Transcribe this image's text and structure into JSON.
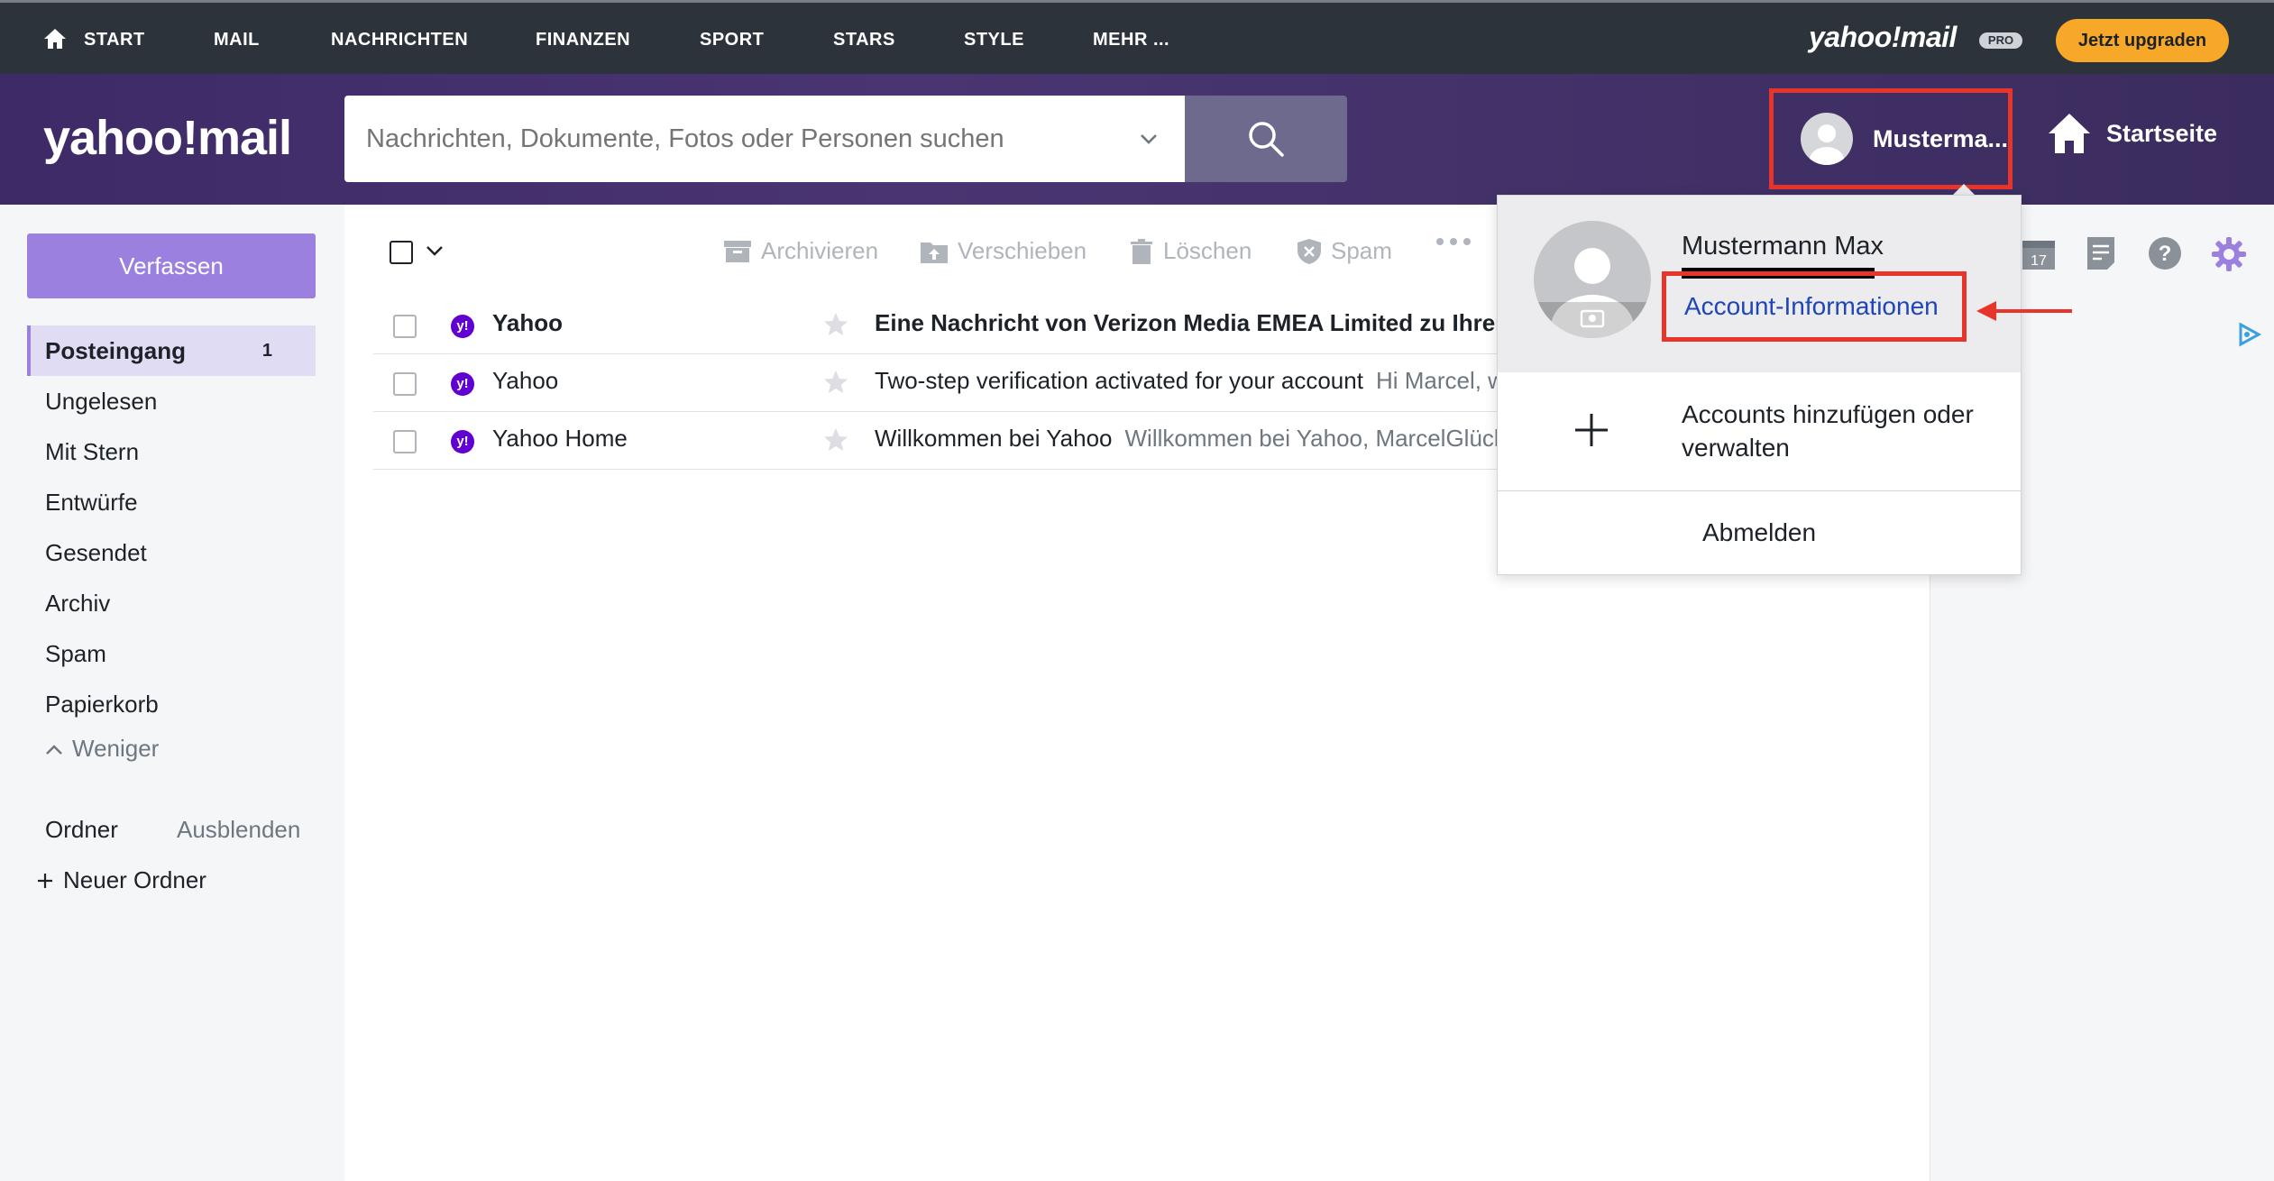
{
  "topnav": {
    "items": [
      "START",
      "MAIL",
      "NACHRICHTEN",
      "FINANZEN",
      "SPORT",
      "STARS",
      "STYLE",
      "MEHR ..."
    ],
    "brand": "yahoo!mail",
    "pro_badge": "PRO",
    "upgrade_label": "Jetzt upgraden"
  },
  "header": {
    "logo": "yahoo!mail",
    "search_placeholder": "Nachrichten, Dokumente, Fotos oder Personen suchen",
    "account_name": "Musterma...",
    "home_label": "Startseite"
  },
  "sidebar": {
    "compose_label": "Verfassen",
    "folders": [
      {
        "label": "Posteingang",
        "count": "1"
      },
      {
        "label": "Ungelesen"
      },
      {
        "label": "Mit Stern"
      },
      {
        "label": "Entwürfe"
      },
      {
        "label": "Gesendet"
      },
      {
        "label": "Archiv"
      },
      {
        "label": "Spam"
      },
      {
        "label": "Papierkorb"
      }
    ],
    "less_label": "Weniger",
    "folders_label": "Ordner",
    "hide_label": "Ausblenden",
    "new_folder_label": "Neuer Ordner"
  },
  "toolbar": {
    "archive": "Archivieren",
    "move": "Verschieben",
    "delete": "Löschen",
    "spam": "Spam"
  },
  "messages": [
    {
      "sender": "Yahoo",
      "subject": "Eine Nachricht von Verizon Media EMEA Limited zu Ihrem",
      "preview": "",
      "unread": true
    },
    {
      "sender": "Yahoo",
      "subject": "Two-step verification activated for your account",
      "preview": "Hi Marcel, wi",
      "unread": false
    },
    {
      "sender": "Yahoo Home",
      "subject": "Willkommen bei Yahoo",
      "preview": "Willkommen bei Yahoo, MarcelGlückw",
      "unread": false
    }
  ],
  "dropdown": {
    "full_name": "Mustermann Max",
    "account_info_label": "Account-Informationen",
    "add_accounts_label": "Accounts hinzufügen oder verwalten",
    "logout_label": "Abmelden"
  },
  "rightpanel": {
    "calendar_day": "17"
  },
  "colors": {
    "header_purple": "#3d2a66",
    "compose": "#9b80e0",
    "upgrade": "#f7a828",
    "highlight_red": "#e8352b",
    "link_blue": "#1f45b8"
  }
}
